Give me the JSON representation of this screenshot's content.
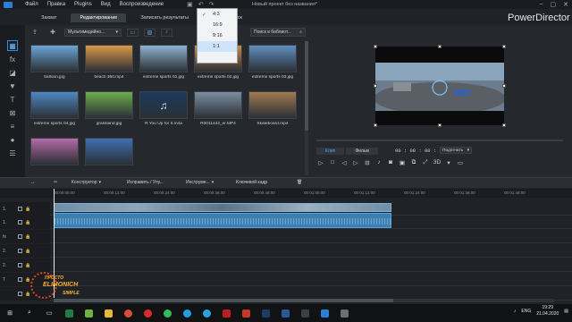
{
  "menu": {
    "items": [
      "Файл",
      "Правка",
      "Plugins",
      "Вид",
      "Воспроизведение"
    ],
    "doc_title": "Новый проект без названия*",
    "brand": "PowerDirector"
  },
  "modes": [
    "Захват",
    "Редактирование",
    "Записать результаты",
    "Создать диск"
  ],
  "library": {
    "media_type": "Мультимедийно...",
    "search_placeholder": "Поиск в библиот...",
    "items": [
      {
        "label": "balloon.jpg",
        "color": "#6aa6d6"
      },
      {
        "label": "beach 360.mp4",
        "color": "#d99848"
      },
      {
        "label": "extreme sports 01.jpg",
        "color": "#8fb3d1"
      },
      {
        "label": "extreme sports 02.jpg",
        "color": "#c98b4a"
      },
      {
        "label": "extreme sports 03.jpg",
        "color": "#5f8fbf"
      },
      {
        "label": "extreme sports 04.jpg",
        "color": "#4e86c2"
      },
      {
        "label": "grassland.jpg",
        "color": "#6cae4e"
      },
      {
        "label": "R You Up for It.m4a",
        "color": "#1b3a5c"
      },
      {
        "label": "R0011443_er.MP4",
        "color": "#7a8da0"
      },
      {
        "label": "Skateboard.mp4",
        "color": "#a07a4e"
      },
      {
        "label": "",
        "color": "#b46aa8"
      },
      {
        "label": "",
        "color": "#3e6fb0"
      }
    ]
  },
  "aspect_menu": {
    "options": [
      "4:3",
      "16:9",
      "9:16",
      "1:1"
    ],
    "checked": "4:3"
  },
  "preview": {
    "tab_clip": "Клип",
    "tab_movie": "Фильм",
    "timecode": "00 : 00 : 00 : 00",
    "fit": "Подогнать",
    "mode_3d": "3D"
  },
  "edit_toolbar": {
    "designer": "Конструктор",
    "fix": "Исправить / Улу...",
    "tools": "Инструме...",
    "keyframe": "Ключевой кадр"
  },
  "ruler": [
    "00:00:00:00",
    "00:00:12:00",
    "00:00:24:00",
    "00:00:36:00",
    "00:00:48:00",
    "00:01:00:00",
    "00:01:12:00",
    "00:01:24:00",
    "00:01:36:00",
    "00:01:48:00",
    "00:02:00:00"
  ],
  "tracks": [
    "1.",
    "1.",
    "fx",
    "2.",
    "2.",
    "T",
    ""
  ],
  "watermark": {
    "line1": "ПРОСТО",
    "line2": "ELIMONICH",
    "line3": "SIMPLE"
  },
  "taskbar": {
    "lang": "ENG",
    "time": "19:29",
    "date": "21.04.2020"
  }
}
